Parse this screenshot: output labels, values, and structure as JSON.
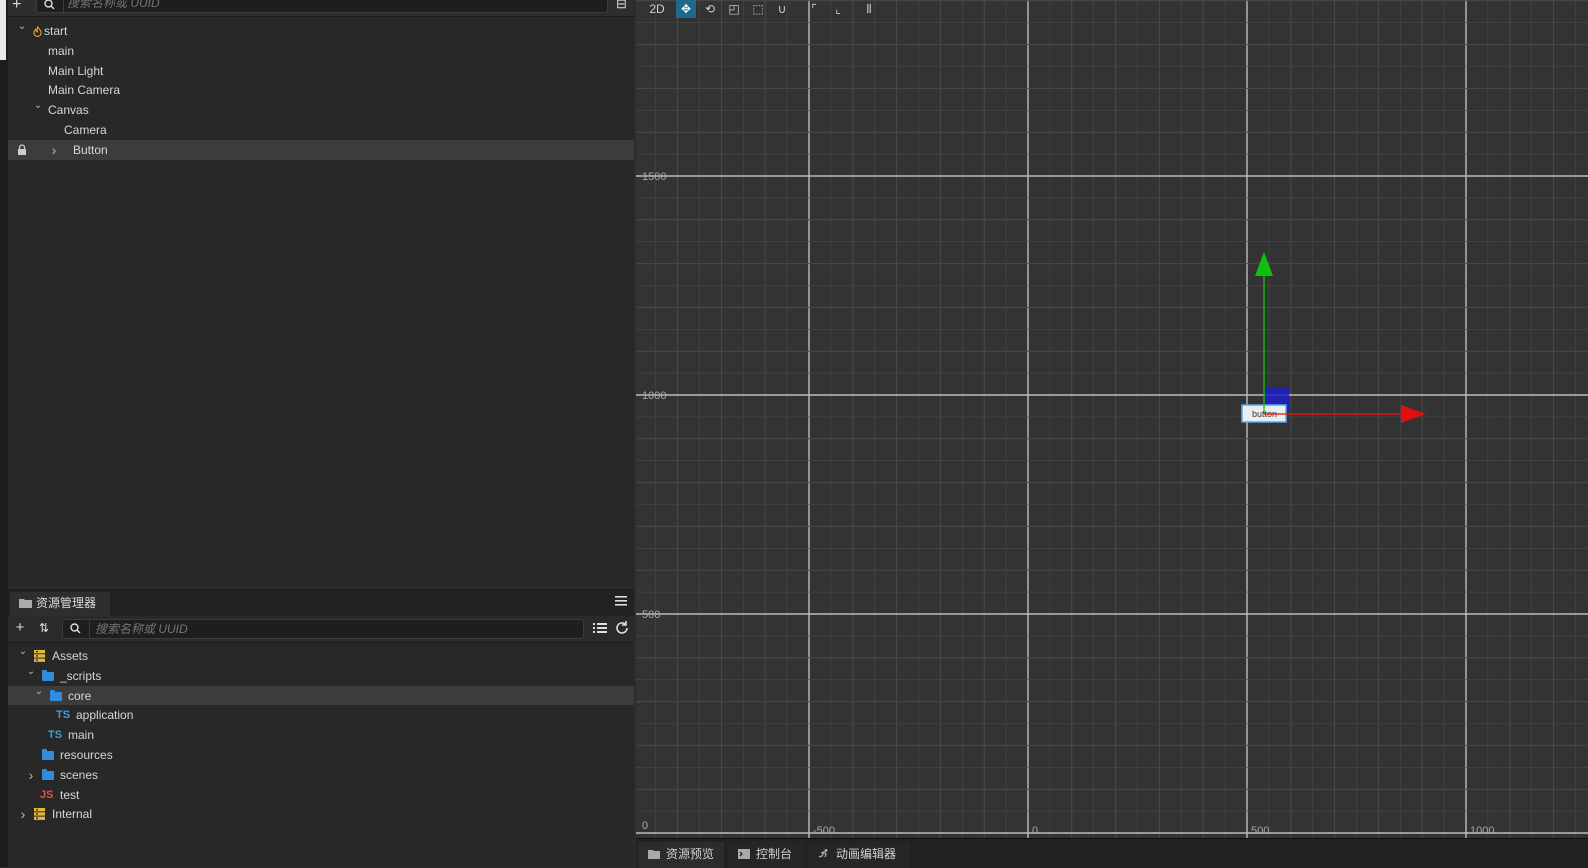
{
  "hierarchy": {
    "search_placeholder": "搜索名称或 UUID",
    "nodes": [
      {
        "label": "start",
        "depth": 0,
        "arrow": "down",
        "icon": "scene-icon"
      },
      {
        "label": "main",
        "depth": 1
      },
      {
        "label": "Main Light",
        "depth": 1
      },
      {
        "label": "Main Camera",
        "depth": 1
      },
      {
        "label": "Canvas",
        "depth": 1,
        "arrow": "down"
      },
      {
        "label": "Camera",
        "depth": 2
      },
      {
        "label": "Button",
        "depth": 2,
        "arrow": "right",
        "selected": true,
        "locked": true
      }
    ]
  },
  "assets": {
    "tab_label": "资源管理器",
    "search_placeholder": "搜索名称或 UUID",
    "items": [
      {
        "label": "Assets",
        "depth": 0,
        "arrow": "down",
        "icon": "database"
      },
      {
        "label": "_scripts",
        "depth": 1,
        "arrow": "down",
        "icon": "folder"
      },
      {
        "label": "core",
        "depth": 2,
        "arrow": "down",
        "icon": "folder",
        "selected": true
      },
      {
        "label": "application",
        "depth": 3,
        "icon": "ts",
        "badge": "TS"
      },
      {
        "label": "main",
        "depth": 2,
        "icon": "ts",
        "badge": "TS"
      },
      {
        "label": "resources",
        "depth": 1,
        "icon": "folder"
      },
      {
        "label": "scenes",
        "depth": 1,
        "arrow": "right",
        "icon": "folder"
      },
      {
        "label": "test",
        "depth": 1,
        "icon": "js",
        "badge": "JS"
      },
      {
        "label": "Internal",
        "depth": 0,
        "arrow": "right",
        "icon": "database"
      }
    ]
  },
  "scene": {
    "mode_label": "2D",
    "y_labels": [
      "1500",
      "1000",
      "500",
      "0"
    ],
    "x_labels": [
      "-500",
      "0",
      "500",
      "1000"
    ],
    "node_label": "button",
    "colors": {
      "x_axis": "#e01010",
      "y_axis": "#10c010",
      "handle": "#2020c8",
      "grid": "#4a4a4a",
      "major": "#bdbdbd"
    }
  },
  "bottom_tabs": [
    {
      "label": "资源预览",
      "icon": "folder-icon"
    },
    {
      "label": "控制台",
      "icon": "terminal-icon"
    },
    {
      "label": "动画编辑器",
      "icon": "running-man-icon"
    }
  ]
}
